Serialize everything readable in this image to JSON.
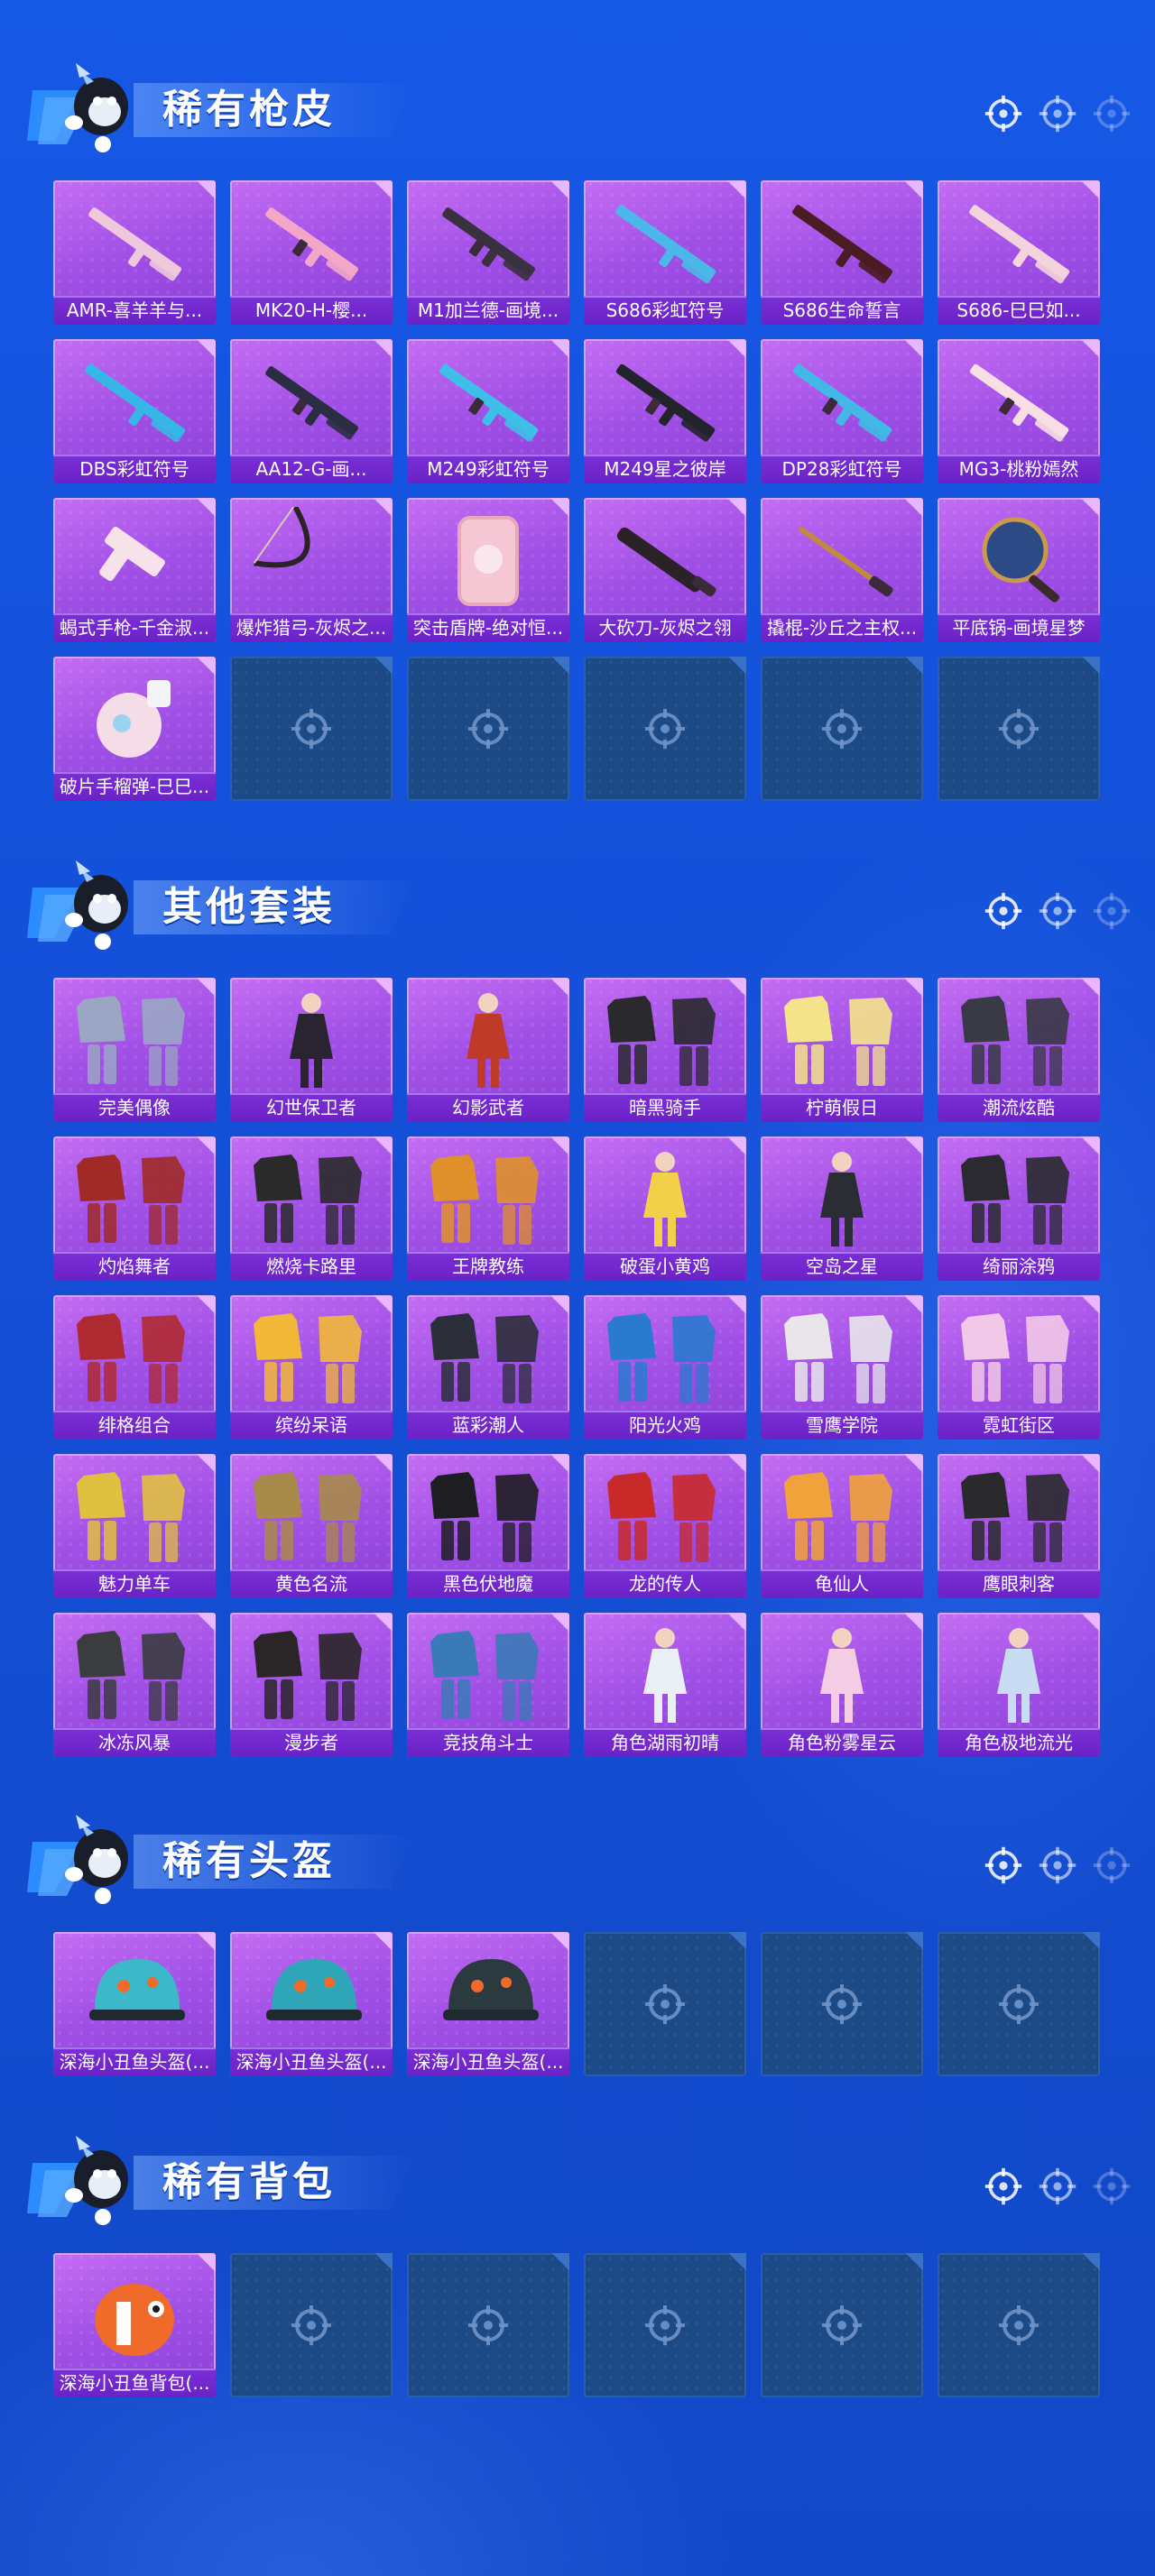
{
  "sections": [
    {
      "title": "稀有枪皮",
      "items": [
        {
          "label": "AMR-喜羊羊与...",
          "icon": "sniper-rifle-icon",
          "color": "#f0c8dc"
        },
        {
          "label": "MK20-H-樱...",
          "icon": "rifle-icon",
          "color": "#f3a6c8"
        },
        {
          "label": "M1加兰德-画境...",
          "icon": "rifle-icon",
          "color": "#3a3140"
        },
        {
          "label": "S686彩虹符号",
          "icon": "shotgun-icon",
          "color": "#4ab8e8"
        },
        {
          "label": "S686生命誓言",
          "icon": "shotgun-icon",
          "color": "#4a1c24"
        },
        {
          "label": "S686-巳巳如...",
          "icon": "shotgun-icon",
          "color": "#f3d3dc"
        },
        {
          "label": "DBS彩虹符号",
          "icon": "shotgun-icon",
          "color": "#36b6e6"
        },
        {
          "label": "AA12-G-画...",
          "icon": "rifle-icon",
          "color": "#2b2d44"
        },
        {
          "label": "M249彩虹符号",
          "icon": "machine-gun-icon",
          "color": "#3cc0e8"
        },
        {
          "label": "M249星之彼岸",
          "icon": "machine-gun-icon",
          "color": "#23232c"
        },
        {
          "label": "DP28彩虹符号",
          "icon": "machine-gun-icon",
          "color": "#42b8e6"
        },
        {
          "label": "MG3-桃粉嫣然",
          "icon": "machine-gun-icon",
          "color": "#f7dfe4"
        },
        {
          "label": "蝎式手枪-千金淑...",
          "icon": "pistol-icon",
          "color": "#f7e2ea"
        },
        {
          "label": "爆炸猎弓-灰烬之...",
          "icon": "bow-icon",
          "color": "#2a2226"
        },
        {
          "label": "突击盾牌-绝对恒...",
          "icon": "shield-icon",
          "color": "#f5c7d4"
        },
        {
          "label": "大砍刀-灰烬之翎",
          "icon": "machete-icon",
          "color": "#2a2226"
        },
        {
          "label": "撬棍-沙丘之主权...",
          "icon": "crowbar-icon",
          "color": "#c28a3c"
        },
        {
          "label": "平底锅-画境星梦",
          "icon": "frying-pan-icon",
          "color": "#2b4a86"
        },
        {
          "label": "破片手榴弹-巳巳...",
          "icon": "grenade-icon",
          "color": "#f4dde6"
        }
      ],
      "empty_count": 5
    },
    {
      "title": "其他套装",
      "items": [
        {
          "label": "完美偶像",
          "icon": "outfit-icon",
          "color": "#9aa6c4"
        },
        {
          "label": "幻世保卫者",
          "icon": "figure-icon",
          "color": "#2a2430"
        },
        {
          "label": "幻影武者",
          "icon": "figure-icon",
          "color": "#c03a2a"
        },
        {
          "label": "暗黑骑手",
          "icon": "outfit-icon",
          "color": "#2a2a2e"
        },
        {
          "label": "柠萌假日",
          "icon": "outfit-icon",
          "color": "#f5e38a"
        },
        {
          "label": "潮流炫酷",
          "icon": "outfit-icon",
          "color": "#3a3a46"
        },
        {
          "label": "灼焰舞者",
          "icon": "outfit-icon",
          "color": "#a02a28"
        },
        {
          "label": "燃烧卡路里",
          "icon": "outfit-icon",
          "color": "#2a2a2a"
        },
        {
          "label": "王牌教练",
          "icon": "outfit-icon",
          "color": "#e0902a"
        },
        {
          "label": "破蛋小黄鸡",
          "icon": "figure-icon",
          "color": "#f2d04a"
        },
        {
          "label": "空岛之星",
          "icon": "figure-icon",
          "color": "#2c2c34"
        },
        {
          "label": "绮丽涂鸦",
          "icon": "outfit-icon",
          "color": "#2a2a30"
        },
        {
          "label": "绯格组合",
          "icon": "outfit-icon",
          "color": "#b02a32"
        },
        {
          "label": "缤纷呆语",
          "icon": "outfit-icon",
          "color": "#f2b838"
        },
        {
          "label": "蓝彩潮人",
          "icon": "outfit-icon",
          "color": "#2c2f3a"
        },
        {
          "label": "阳光火鸡",
          "icon": "outfit-icon",
          "color": "#2a7ad0"
        },
        {
          "label": "雪鹰学院",
          "icon": "outfit-icon",
          "color": "#e8e6ea"
        },
        {
          "label": "霓虹街区",
          "icon": "outfit-icon",
          "color": "#f2c8e8"
        },
        {
          "label": "魅力单车",
          "icon": "outfit-icon",
          "color": "#e0c040"
        },
        {
          "label": "黄色名流",
          "icon": "outfit-icon",
          "color": "#a88a4a"
        },
        {
          "label": "黑色伏地魔",
          "icon": "outfit-icon",
          "color": "#1e1e22"
        },
        {
          "label": "龙的传人",
          "icon": "outfit-icon",
          "color": "#c82a2a"
        },
        {
          "label": "龟仙人",
          "icon": "outfit-icon",
          "color": "#f2a23a"
        },
        {
          "label": "鹰眼刺客",
          "icon": "outfit-icon",
          "color": "#2a2a2c"
        },
        {
          "label": "冰冻风暴",
          "icon": "outfit-icon",
          "color": "#3a3c40"
        },
        {
          "label": "漫步者",
          "icon": "outfit-icon",
          "color": "#2a2628"
        },
        {
          "label": "竞技角斗士",
          "icon": "outfit-icon",
          "color": "#3a7ab8"
        },
        {
          "label": "角色湖雨初晴",
          "icon": "figure-icon",
          "color": "#e8f0f6"
        },
        {
          "label": "角色粉雾星云",
          "icon": "figure-icon",
          "color": "#f4cde4"
        },
        {
          "label": "角色极地流光",
          "icon": "figure-icon",
          "color": "#c8dcf4"
        }
      ],
      "empty_count": 0
    },
    {
      "title": "稀有头盔",
      "items": [
        {
          "label": "深海小丑鱼头盔(...",
          "icon": "helmet-icon",
          "color": "#3cb8c8"
        },
        {
          "label": "深海小丑鱼头盔(...",
          "icon": "helmet-icon",
          "color": "#2ea6b8"
        },
        {
          "label": "深海小丑鱼头盔(...",
          "icon": "helmet-icon",
          "color": "#2a3a3e"
        }
      ],
      "empty_count": 3
    },
    {
      "title": "稀有背包",
      "items": [
        {
          "label": "深海小丑鱼背包(...",
          "icon": "backpack-icon",
          "color": "#f06a2a"
        }
      ],
      "empty_count": 5
    }
  ]
}
